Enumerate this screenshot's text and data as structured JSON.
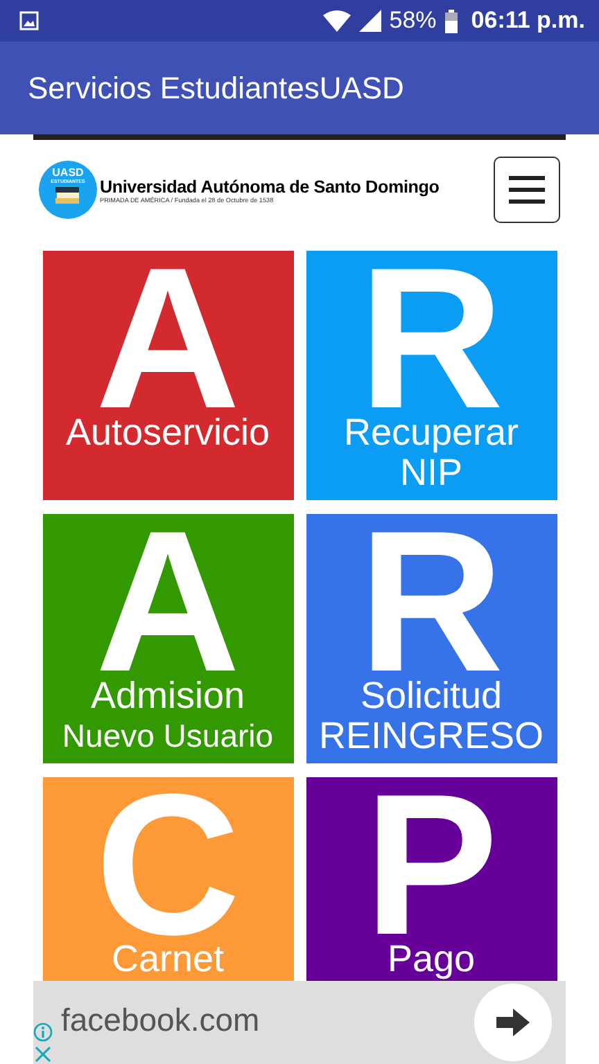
{
  "status_bar": {
    "battery": "58%",
    "time": "06:11 p.m."
  },
  "app_bar": {
    "title": "Servicios EstudiantesUASD"
  },
  "header": {
    "logo_top": "UASD",
    "logo_bottom": "ESTUDIANTES",
    "title": "Universidad Autónoma de Santo Domingo",
    "subtitle": "PRIMADA DE AMÉRICA / Fundada el 28 de Octubre de 1538"
  },
  "tiles": [
    {
      "letter": "A",
      "lines": [
        "Autoservicio"
      ],
      "color": "#d32a2f"
    },
    {
      "letter": "R",
      "lines": [
        "Recuperar",
        "NIP"
      ],
      "color": "#0b9cf4"
    },
    {
      "letter": "A",
      "lines": [
        "Admision",
        "Nuevo Usuario"
      ],
      "color": "#339900"
    },
    {
      "letter": "R",
      "lines": [
        "Solicitud",
        "REINGRESO"
      ],
      "color": "#3672e8"
    },
    {
      "letter": "C",
      "lines": [
        "Carnet"
      ],
      "color": "#fd9a37"
    },
    {
      "letter": "P",
      "lines": [
        "Pago"
      ],
      "color": "#660099"
    }
  ],
  "ad": {
    "domain": "facebook.com"
  }
}
